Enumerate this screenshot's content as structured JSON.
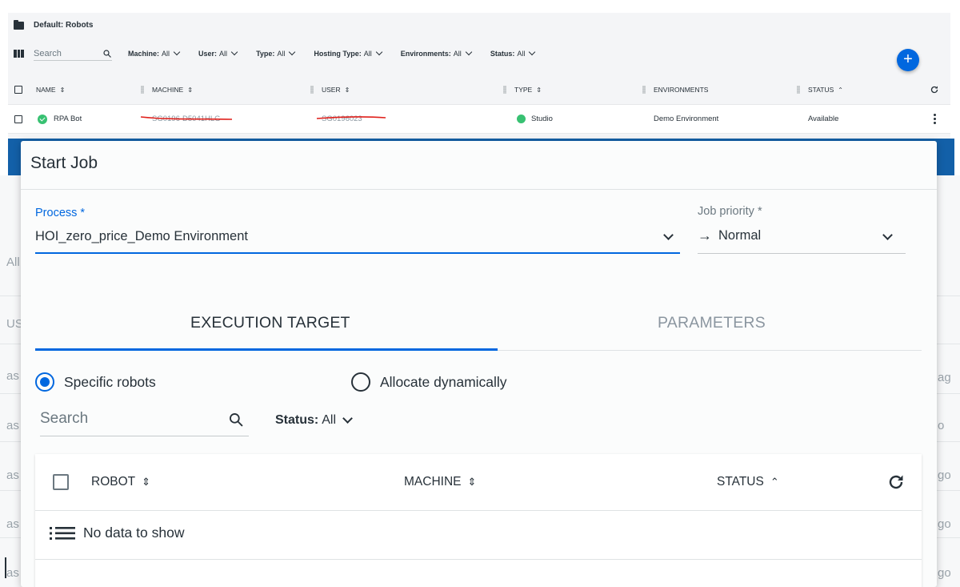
{
  "background": {
    "breadcrumb": "Default: Robots",
    "search_placeholder": "Search",
    "filters": [
      {
        "label": "Machine:",
        "value": "All"
      },
      {
        "label": "User:",
        "value": "All"
      },
      {
        "label": "Type:",
        "value": "All"
      },
      {
        "label": "Hosting Type:",
        "value": "All"
      },
      {
        "label": "Environments:",
        "value": "All"
      },
      {
        "label": "Status:",
        "value": "All"
      }
    ],
    "add_label": "+",
    "columns": {
      "name": "NAME",
      "machine": "MACHINE",
      "user": "USER",
      "type": "TYPE",
      "environments": "ENVIRONMENTS",
      "status": "STATUS"
    },
    "row": {
      "name": "RPA Bot",
      "machine": "SG0196-D5041HLG",
      "user": "SG0196023",
      "type": "Studio",
      "environment": "Demo Environment",
      "status": "Available"
    },
    "dim_fragments": [
      "All",
      "US",
      "as",
      "ag",
      "as",
      "o",
      "as",
      "go",
      "as",
      "go",
      "as",
      "go"
    ]
  },
  "dialog": {
    "title": "Start Job",
    "process_label": "Process *",
    "process_value": "HOI_zero_price_Demo Environment",
    "priority_label": "Job priority *",
    "priority_value": "Normal",
    "tabs": [
      "EXECUTION TARGET",
      "PARAMETERS"
    ],
    "radio_specific": "Specific robots",
    "radio_dynamic": "Allocate dynamically",
    "search_placeholder": "Search",
    "status_filter_label": "Status:",
    "status_filter_value": "All",
    "grid_columns": {
      "robot": "ROBOT",
      "machine": "MACHINE",
      "status": "STATUS"
    },
    "empty_text": "No data to show"
  },
  "colors": {
    "accent": "#0067df",
    "header_band": "#1360a8",
    "success": "#38c172",
    "redaction": "#e0201b"
  }
}
